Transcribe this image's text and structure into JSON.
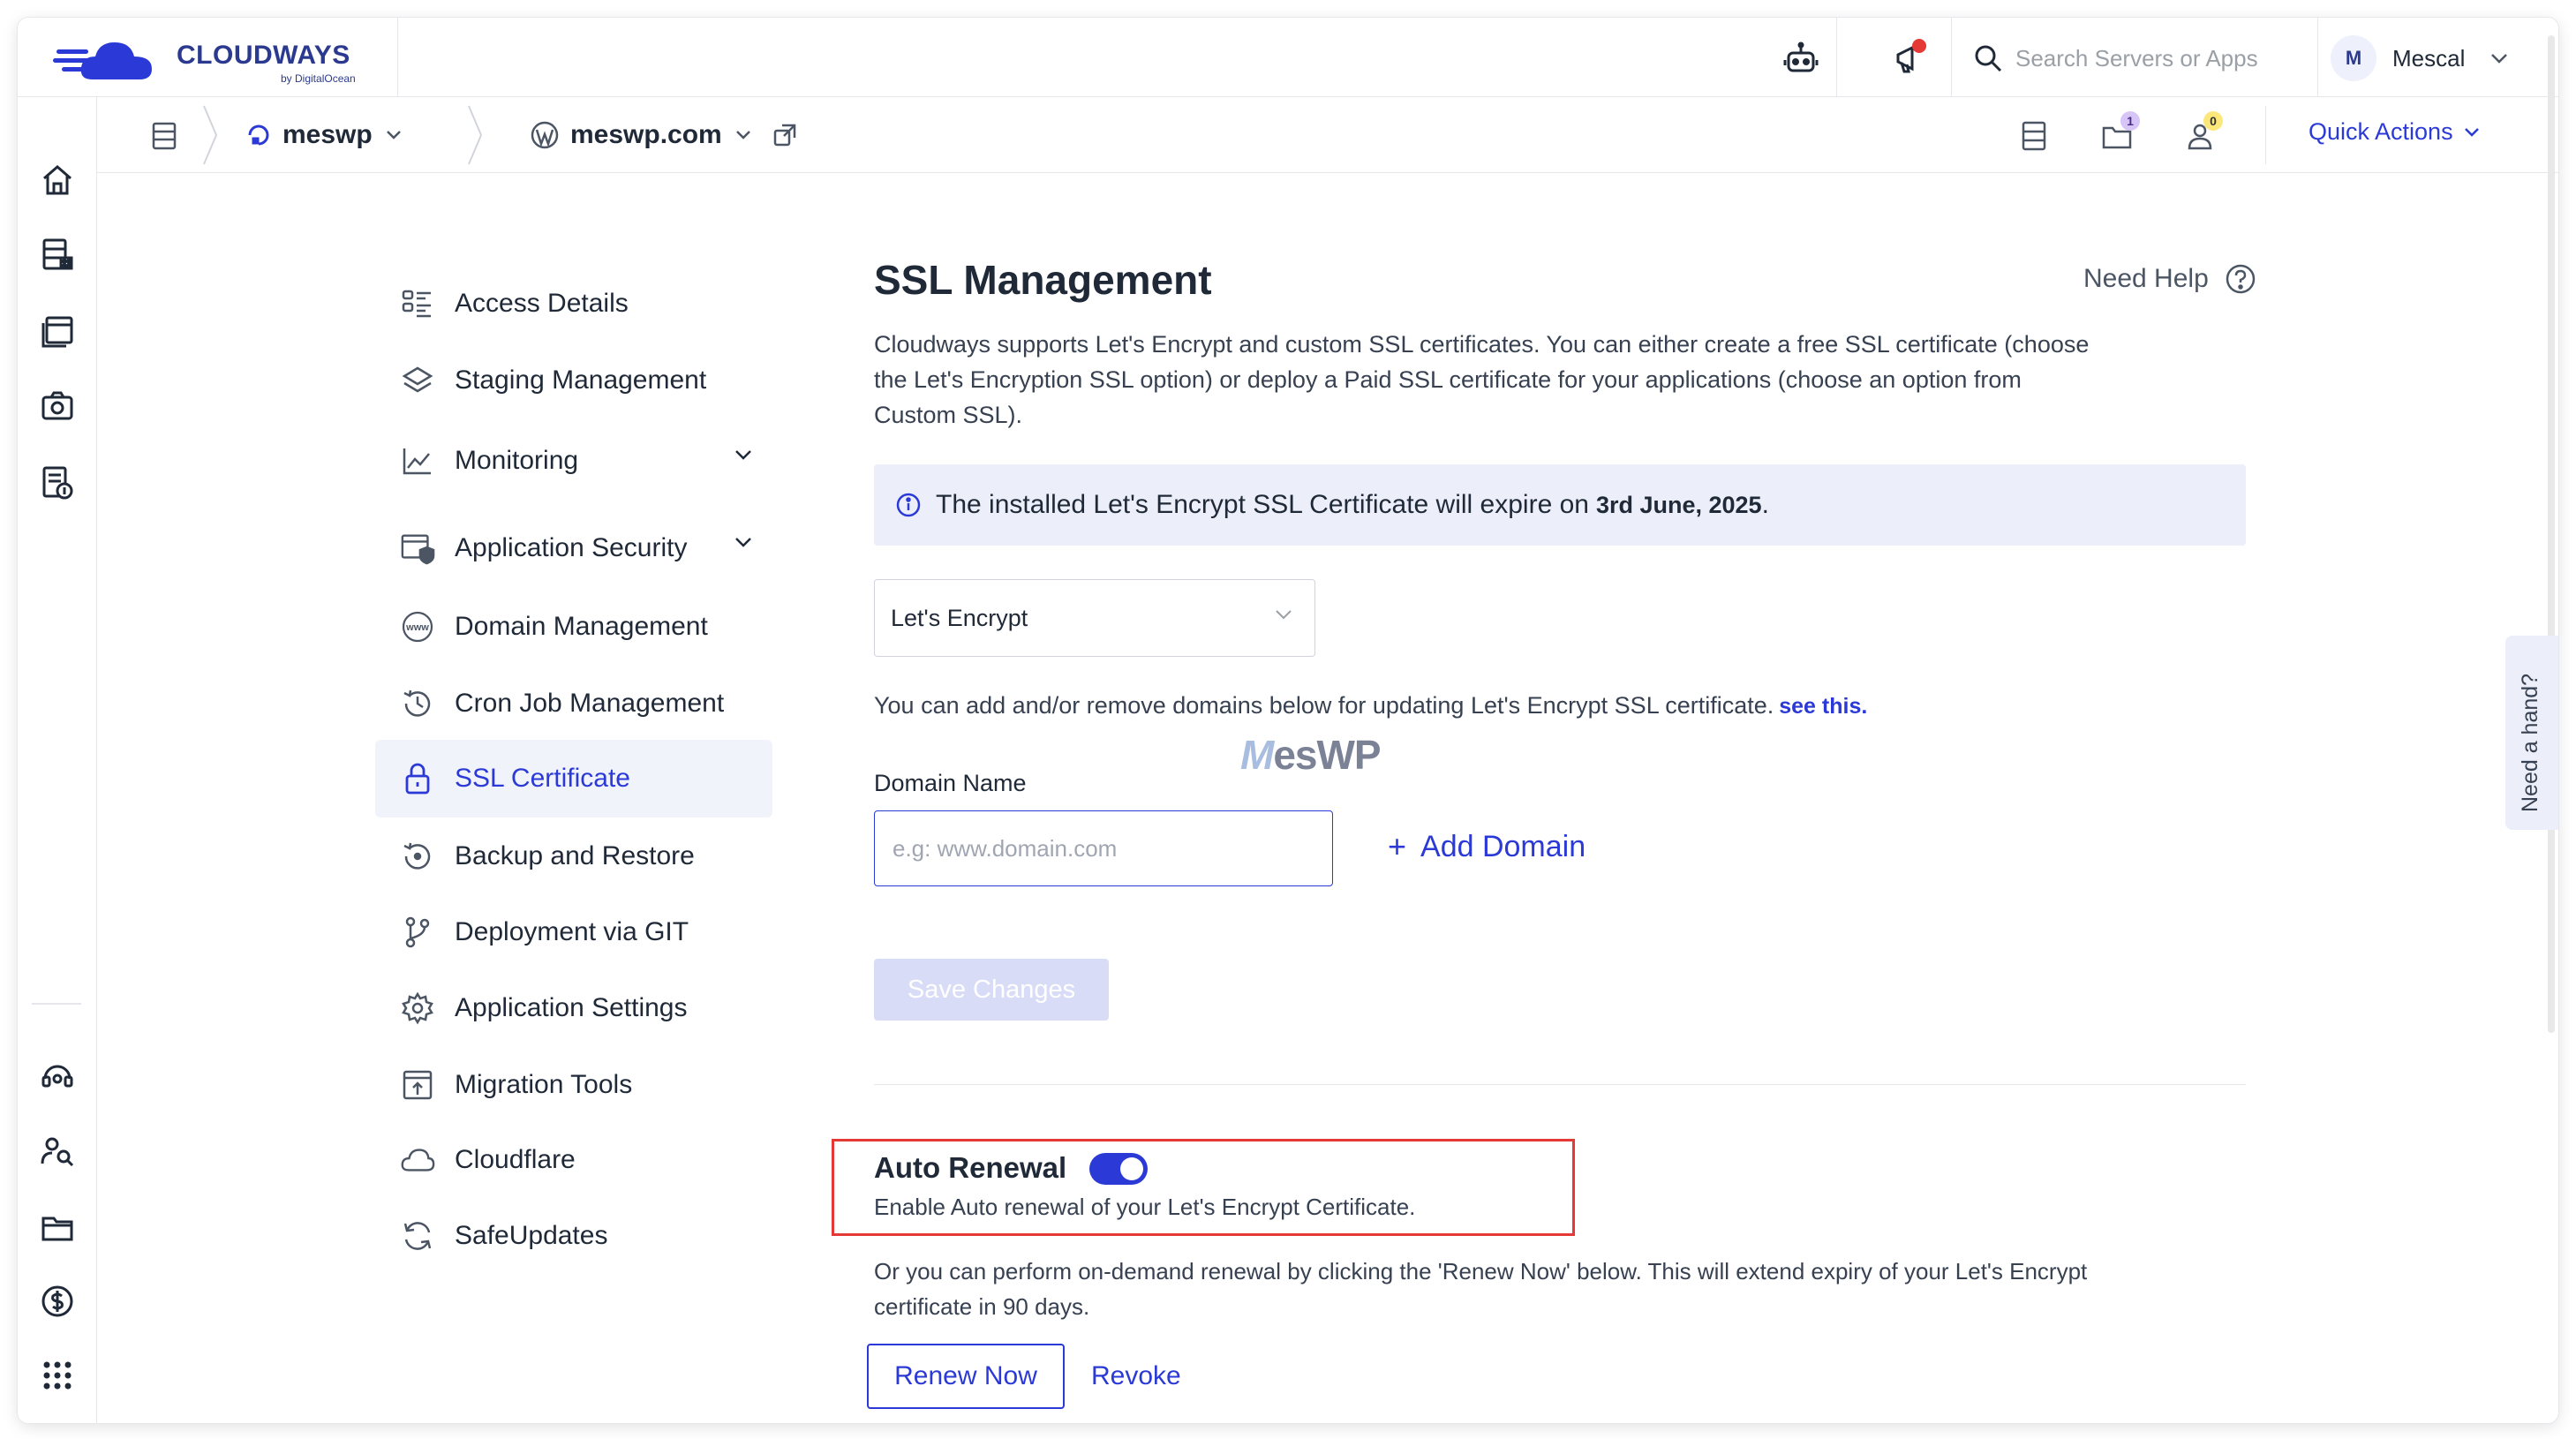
{
  "brand": {
    "name": "CLOUDWAYS",
    "sub": "by DigitalOcean"
  },
  "topbar": {
    "search_placeholder": "Search Servers or Apps",
    "user_initial": "M",
    "user_name": "Mescal"
  },
  "breadcrumb": {
    "server": "meswp",
    "app": "meswp.com"
  },
  "toolbar": {
    "folder_badge": "1",
    "users_badge": "0",
    "quick_actions": "Quick Actions"
  },
  "sidenav": {
    "items": [
      {
        "label": "Access Details"
      },
      {
        "label": "Staging Management"
      },
      {
        "label": "Monitoring"
      },
      {
        "label": "Application Security"
      },
      {
        "label": "Domain Management"
      },
      {
        "label": "Cron Job Management"
      },
      {
        "label": "SSL Certificate"
      },
      {
        "label": "Backup and Restore"
      },
      {
        "label": "Deployment via GIT"
      },
      {
        "label": "Application Settings"
      },
      {
        "label": "Migration Tools"
      },
      {
        "label": "Cloudflare"
      },
      {
        "label": "SafeUpdates"
      }
    ]
  },
  "main": {
    "title": "SSL Management",
    "need_help": "Need Help",
    "intro": "Cloudways supports Let's Encrypt and custom SSL certificates. You can either create a free SSL certificate (choose the Let's Encryption SSL option) or deploy a Paid SSL certificate for your applications (choose an option from Custom SSL).",
    "info_text": "The installed Let's Encrypt SSL Certificate will expire on",
    "info_date": "3rd June, 2025",
    "info_end": ".",
    "ssl_type": "Let's Encrypt",
    "domains_note": "You can add and/or remove domains below for updating Let's Encrypt SSL certificate.",
    "see_this": "see this.",
    "watermark_m": "M",
    "watermark_rest": "esWP",
    "domain_label": "Domain Name",
    "domain_placeholder": "e.g: www.domain.com",
    "add_domain": "Add Domain",
    "save_changes": "Save Changes",
    "auto_renewal_title": "Auto Renewal",
    "auto_renewal_enabled": true,
    "auto_renewal_desc": "Enable Auto renewal of your Let's Encrypt Certificate.",
    "renew_note": "Or you can perform on-demand renewal by clicking the 'Renew Now' below. This will extend expiry of your Let's Encrypt certificate in 90 days.",
    "renew_now": "Renew Now",
    "revoke": "Revoke"
  },
  "need_a_hand": "Need a hand?",
  "colors": {
    "accent": "#2b3ad6",
    "brand": "#2b3a8f",
    "highlight": "#e53935"
  }
}
